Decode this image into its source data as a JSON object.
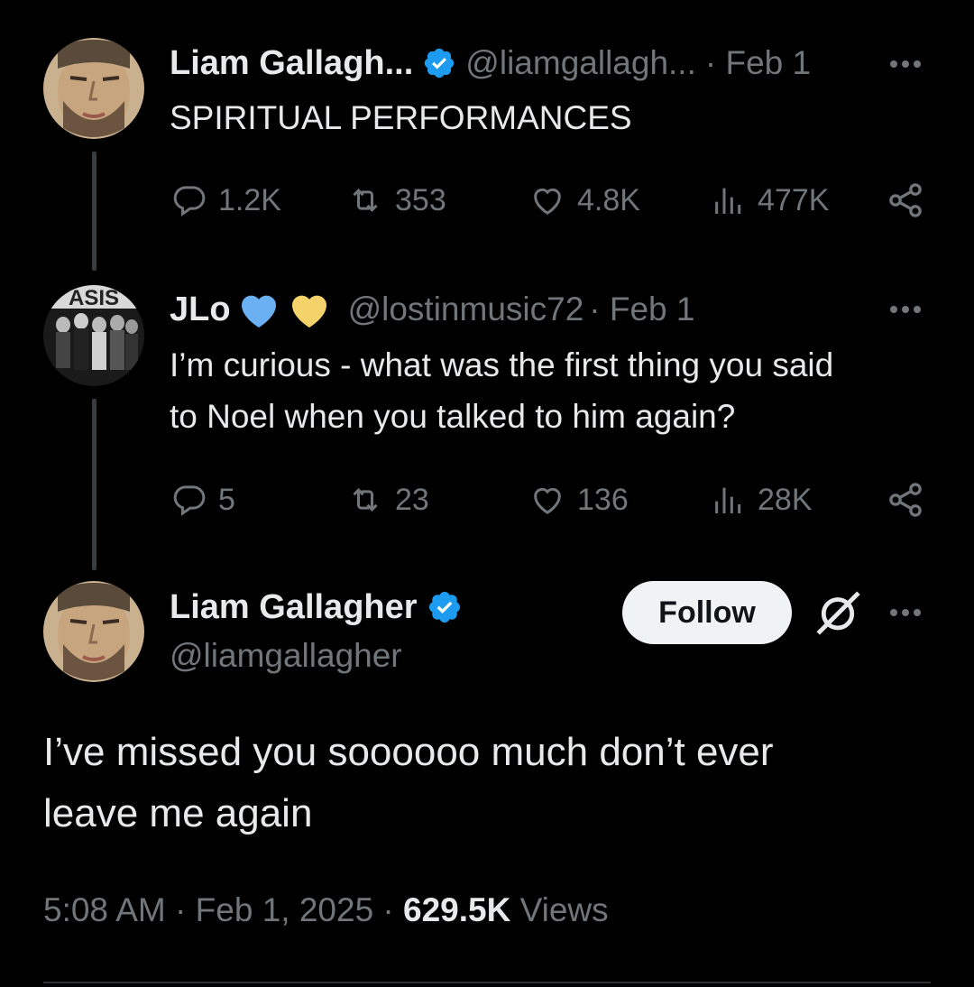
{
  "colors": {
    "background": "#000000",
    "text": "#e7e9ea",
    "muted": "#71767b",
    "verified": "#1d9bf0",
    "heart_blue": "#6ab0f3",
    "heart_yellow": "#f5d36b"
  },
  "tweet1": {
    "name": "Liam Gallagh...",
    "handle": "@liamgallagh...",
    "date": "· Feb 1",
    "text": "SPIRITUAL PERFORMANCES",
    "replies": "1.2K",
    "reposts": "353",
    "likes": "4.8K",
    "views": "477K"
  },
  "tweet2": {
    "name": "JLo",
    "name_emojis": [
      "blue-heart",
      "yellow-heart"
    ],
    "handle": "@lostinmusic72",
    "date": "· Feb 1",
    "text_line1": "I’m curious - what was the first thing you said",
    "text_line2": "to Noel when you talked to him again?",
    "replies": "5",
    "reposts": "23",
    "likes": "136",
    "views": "28K"
  },
  "main": {
    "name": "Liam Gallagher",
    "handle": "@liamgallagher",
    "follow_label": "Follow",
    "text_line1": "I’ve missed you soooooo much don’t ever",
    "text_line2": "leave me again",
    "time": "5:08 AM",
    "date": "Feb 1, 2025",
    "views_count": "629.5K",
    "views_label": "Views",
    "sep": "·"
  }
}
